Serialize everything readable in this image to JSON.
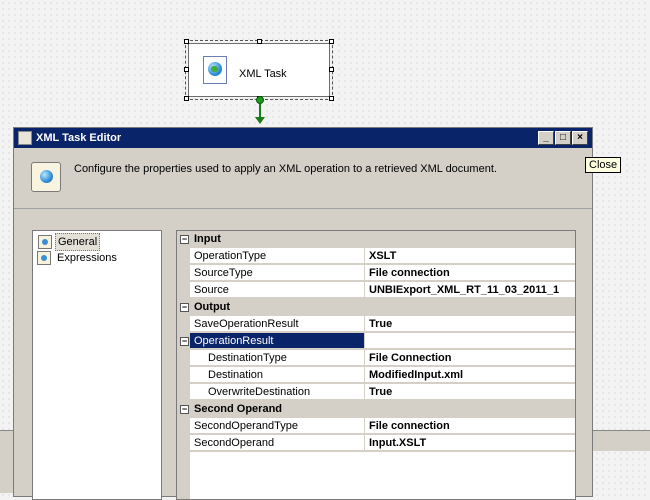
{
  "canvas": {
    "task_label": "XML Task"
  },
  "dialog": {
    "title": "XML Task Editor",
    "buttons": {
      "minimize": "_",
      "maximize": "□",
      "close": "×"
    },
    "header_text": "Configure the properties used to apply an XML operation to a retrieved XML document.",
    "tree": [
      {
        "label": "General",
        "selected": true
      },
      {
        "label": "Expressions",
        "selected": false
      }
    ],
    "grid": {
      "categories": {
        "input": "Input",
        "output": "Output",
        "second_operand": "Second Operand"
      },
      "rows": {
        "operation_type": {
          "name": "OperationType",
          "value": "XSLT"
        },
        "source_type": {
          "name": "SourceType",
          "value": "File connection"
        },
        "source": {
          "name": "Source",
          "value": "UNBIExport_XML_RT_11_03_2011_1"
        },
        "save_operation_result": {
          "name": "SaveOperationResult",
          "value": "True"
        },
        "operation_result": {
          "name": "OperationResult",
          "value": ""
        },
        "destination_type": {
          "name": "DestinationType",
          "value": "File Connection"
        },
        "destination": {
          "name": "Destination",
          "value": "ModifiedInput.xml"
        },
        "overwrite_destination": {
          "name": "OverwriteDestination",
          "value": "True"
        },
        "second_operand_type": {
          "name": "SecondOperandType",
          "value": "File connection"
        },
        "second_operand": {
          "name": "SecondOperand",
          "value": "Input.XSLT"
        }
      }
    }
  },
  "tooltip": "Close",
  "colors": {
    "titlebar": "#0a246a",
    "selection": "#0a246a",
    "connector": "#1c7d1c",
    "dialog_face": "#d4d0c8"
  }
}
